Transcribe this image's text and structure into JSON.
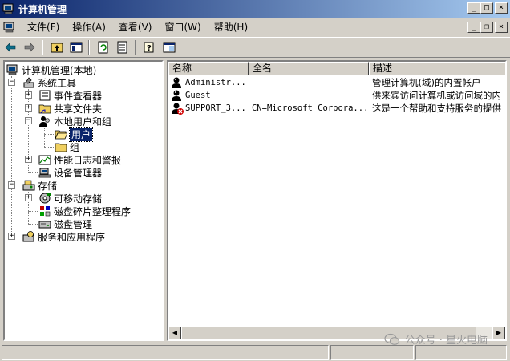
{
  "window": {
    "title": "计算机管理",
    "minimize_glyph": "_",
    "maximize_glyph": "□",
    "close_glyph": "×",
    "restore_glyph": "❐"
  },
  "menubar": {
    "items": [
      {
        "label": "文件",
        "accel": "(F)"
      },
      {
        "label": "操作",
        "accel": "(A)"
      },
      {
        "label": "查看",
        "accel": "(V)"
      },
      {
        "label": "窗口",
        "accel": "(W)"
      },
      {
        "label": "帮助",
        "accel": "(H)"
      }
    ]
  },
  "toolbar": {
    "icons": [
      "back-arrow-icon",
      "forward-arrow-icon",
      "up-folder-icon",
      "show-hide-tree-icon",
      "refresh-icon",
      "export-list-icon",
      "help-icon",
      "mmc-view-icon"
    ]
  },
  "tree": {
    "root": "计算机管理(本地)",
    "system_tools": "系统工具",
    "event_viewer": "事件查看器",
    "shared_folders": "共享文件夹",
    "local_users_groups": "本地用户和组",
    "users": "用户",
    "groups": "组",
    "perf_logs": "性能日志和警报",
    "device_manager": "设备管理器",
    "storage": "存储",
    "removable_storage": "可移动存储",
    "disk_defrag": "磁盘碎片整理程序",
    "disk_management": "磁盘管理",
    "services_apps": "服务和应用程序",
    "expander_plus": "+",
    "expander_minus": "−"
  },
  "list": {
    "columns": [
      {
        "label": "名称"
      },
      {
        "label": "全名"
      },
      {
        "label": "描述"
      }
    ],
    "rows": [
      {
        "name": "Administr...",
        "full_name": "",
        "description": "管理计算机(域)的内置帐户",
        "icon": "user-icon",
        "disabled": false
      },
      {
        "name": "Guest",
        "full_name": "",
        "description": "供来宾访问计算机或访问域的内",
        "icon": "user-icon",
        "disabled": false
      },
      {
        "name": "SUPPORT_3...",
        "full_name": "CN=Microsoft Corpora...",
        "description": "这是一个帮助和支持服务的提供",
        "icon": "disabled-user-icon",
        "disabled": true
      }
    ]
  },
  "scrollbar": {
    "left_glyph": "◀",
    "right_glyph": "▶"
  },
  "watermark": {
    "text": "公众号 · 星火电脑"
  },
  "colors": {
    "titlebar_start": "#0a246a",
    "titlebar_end": "#a6caf0",
    "face": "#d4d0c8",
    "selection": "#0a246a"
  }
}
